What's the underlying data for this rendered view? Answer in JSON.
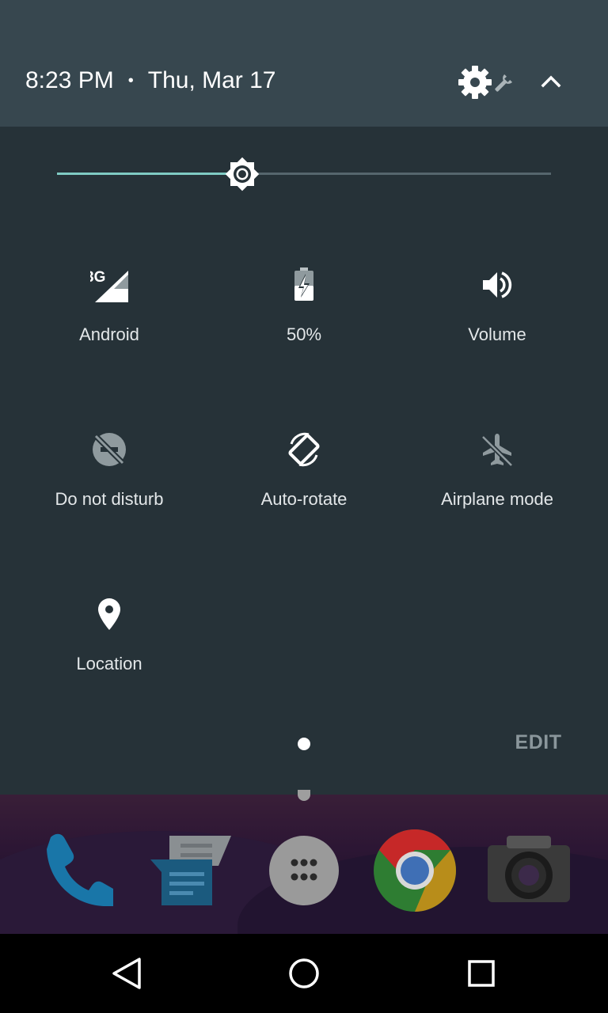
{
  "header": {
    "time": "8:23 PM",
    "separator": "•",
    "date": "Thu, Mar 17"
  },
  "brightness": {
    "level": 0.375
  },
  "tiles": [
    {
      "label": "Android",
      "icon": "signal-3g-icon"
    },
    {
      "label": "50%",
      "icon": "battery-charging-icon"
    },
    {
      "label": "Volume",
      "icon": "volume-icon"
    },
    {
      "label": "Do not disturb",
      "icon": "do-not-disturb-off-icon"
    },
    {
      "label": "Auto-rotate",
      "icon": "auto-rotate-icon"
    },
    {
      "label": "Airplane mode",
      "icon": "airplane-off-icon"
    },
    {
      "label": "Location",
      "icon": "location-pin-icon"
    }
  ],
  "signal_badge": "3G",
  "edit_label": "EDIT",
  "dock": [
    "phone-icon",
    "messages-icon",
    "app-drawer-icon",
    "chrome-icon",
    "camera-icon"
  ],
  "navbar": [
    "back-icon",
    "home-icon",
    "recents-icon"
  ],
  "colors": {
    "header_bg": "#37474f",
    "panel_bg": "#263238",
    "accent": "#80cbc4"
  }
}
